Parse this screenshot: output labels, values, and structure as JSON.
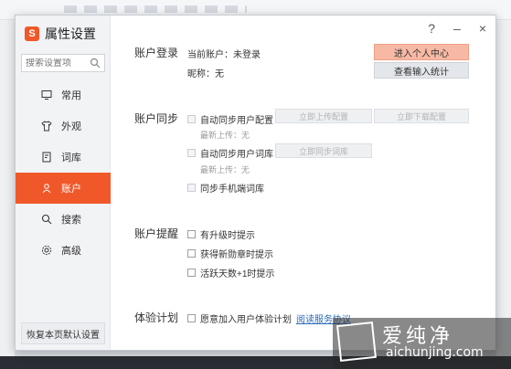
{
  "dialog": {
    "title": "属性设置",
    "logo_glyph": "S",
    "controls": {
      "help": "?",
      "minimize": "–",
      "close": "×"
    }
  },
  "sidebar": {
    "search_placeholder": "搜索设置项",
    "items": [
      {
        "label": "常用",
        "icon": "monitor-icon"
      },
      {
        "label": "外观",
        "icon": "tshirt-icon"
      },
      {
        "label": "词库",
        "icon": "book-icon"
      },
      {
        "label": "账户",
        "icon": "user-icon",
        "active": true
      },
      {
        "label": "搜索",
        "icon": "search-icon"
      },
      {
        "label": "高级",
        "icon": "gear-icon"
      }
    ],
    "restore_label": "恢复本页默认设置"
  },
  "account_login": {
    "section": "账户登录",
    "current_account": "当前账户：未登录",
    "nickname": "昵称：无",
    "enter_center": "进入个人中心",
    "view_stats": "查看输入统计"
  },
  "account_sync": {
    "section": "账户同步",
    "auto_sync_config": "自动同步用户配置",
    "upload_config": "立即上传配置",
    "download_config": "立即下载配置",
    "latest_upload_1": "最新上传：无",
    "auto_sync_dict": "自动同步用户词库",
    "sync_dict_now": "立即同步词库",
    "latest_upload_2": "最新上传：无",
    "sync_mobile_dict": "同步手机端词库"
  },
  "account_reminder": {
    "section": "账户提醒",
    "upgrade_reminder": "有升级时提示",
    "badge_reminder": "获得新勋章时提示",
    "active_days_reminder": "活跃天数+1时提示"
  },
  "experience": {
    "section": "体验计划",
    "join_label": "愿意加入用户体验计划",
    "agreement_link": "阅读服务协议"
  },
  "watermark": {
    "cn": "爱纯净",
    "en": "aichunjing.com"
  },
  "colors": {
    "accent": "#f0582a",
    "primary_button": "#f8b9a4",
    "link": "#2a6ab8"
  }
}
